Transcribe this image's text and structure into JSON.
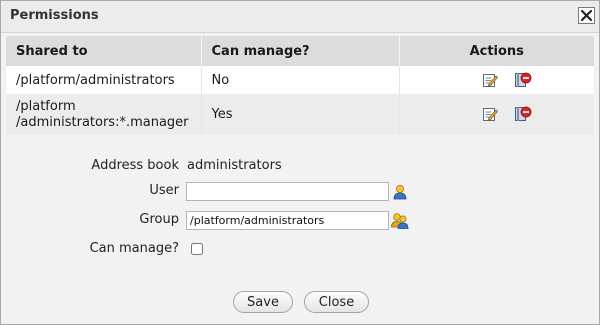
{
  "dialog": {
    "title": "Permissions"
  },
  "table": {
    "headers": {
      "shared_to": "Shared to",
      "can_manage": "Can manage?",
      "actions": "Actions"
    },
    "rows": [
      {
        "shared_to": "/platform/administrators",
        "can_manage": "No"
      },
      {
        "shared_to_line1": "/platform",
        "shared_to_line2": "/administrators:*.manager",
        "can_manage": "Yes"
      }
    ],
    "row_actions": [
      "edit-icon",
      "delete-icon"
    ]
  },
  "form": {
    "address_book_label": "Address book",
    "address_book_value": "administrators",
    "user_label": "User",
    "user_value": "",
    "group_label": "Group",
    "group_value": "/platform/administrators",
    "can_manage_label": "Can manage?",
    "can_manage_checked": false
  },
  "buttons": {
    "save": "Save",
    "close": "Close"
  },
  "colors": {
    "header_bg": "#dcdcdc",
    "dialog_bg": "#f2f2f2",
    "delete_red": "#d9262c"
  }
}
